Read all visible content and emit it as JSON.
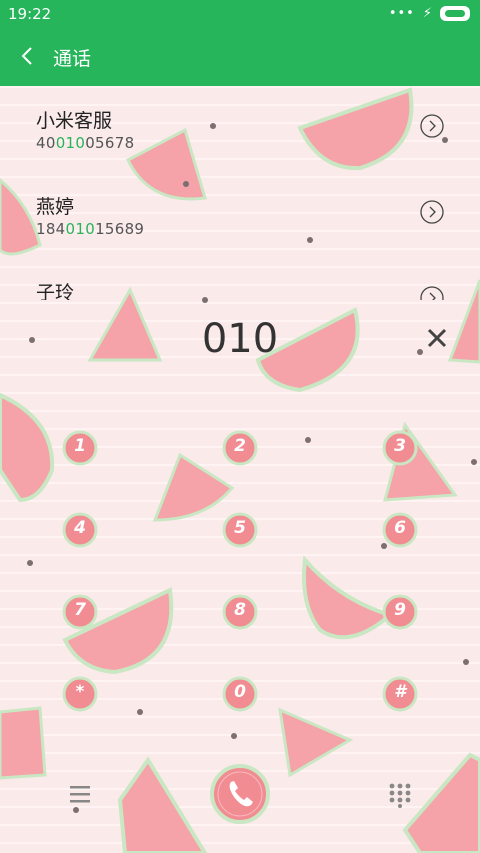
{
  "status": {
    "time": "19:22",
    "dots": "•••",
    "bolt": "⚡"
  },
  "header": {
    "title": "通话"
  },
  "contacts": [
    {
      "name": "小米客服",
      "num_pre": "40",
      "num_match": "010",
      "num_post": "05678"
    },
    {
      "name": "燕婷",
      "num_pre": "184",
      "num_match": "010",
      "num_post": "15689"
    },
    {
      "name": "子玲",
      "num_pre": "",
      "num_match": "",
      "num_post": ""
    }
  ],
  "dialer": {
    "typed": "010",
    "keys": [
      "1",
      "2",
      "3",
      "4",
      "5",
      "6",
      "7",
      "8",
      "9",
      "*",
      "0",
      "#"
    ]
  },
  "colors": {
    "accent": "#26b55b",
    "background": "#fbeaea",
    "watermelon": "#f28c93"
  },
  "icons": {
    "back": "chevron-left-icon",
    "more": "chevron-right-circle-icon",
    "clear": "close-icon",
    "menu": "menu-icon",
    "call": "phone-icon",
    "keypad": "keypad-icon"
  }
}
